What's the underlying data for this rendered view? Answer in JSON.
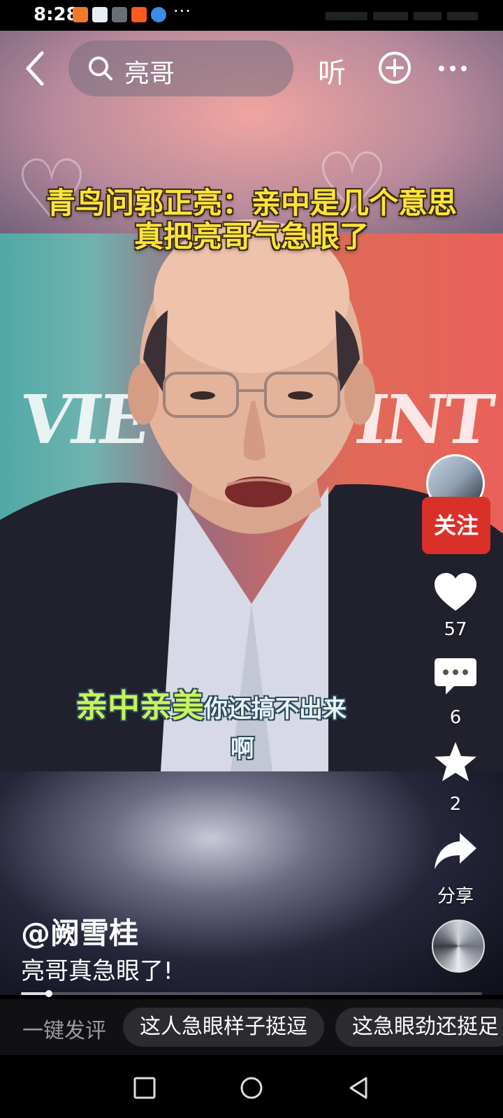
{
  "status_bar": {
    "time": "8:28",
    "more": "···"
  },
  "top_bar": {
    "search_query": "亮哥",
    "listen_label": "听"
  },
  "video": {
    "title_line1": "青鸟问郭正亮：亲中是几个意思",
    "title_line2": "真把亮哥气急眼了",
    "subtitle_line1_green": "亲中亲美",
    "subtitle_line1_white": "你还搞不出来",
    "subtitle_line2": "啊",
    "watermark_left": "VIE",
    "watermark_right": "INT"
  },
  "side_rail": {
    "follow_label": "关注",
    "likes": "57",
    "comments": "6",
    "favorites": "2",
    "share_label": "分享"
  },
  "post": {
    "author": "@阙雪桂",
    "description": "亮哥真急眼了!",
    "progress": 0.06
  },
  "comment_bar": {
    "label": "一键发评",
    "chips": [
      "这人急眼样子挺逗",
      "这急眼劲还挺足"
    ]
  },
  "colors": {
    "follow": "#d9302a",
    "title_yellow": "#ffe33a",
    "subtitle_green": "#c8f35a"
  }
}
